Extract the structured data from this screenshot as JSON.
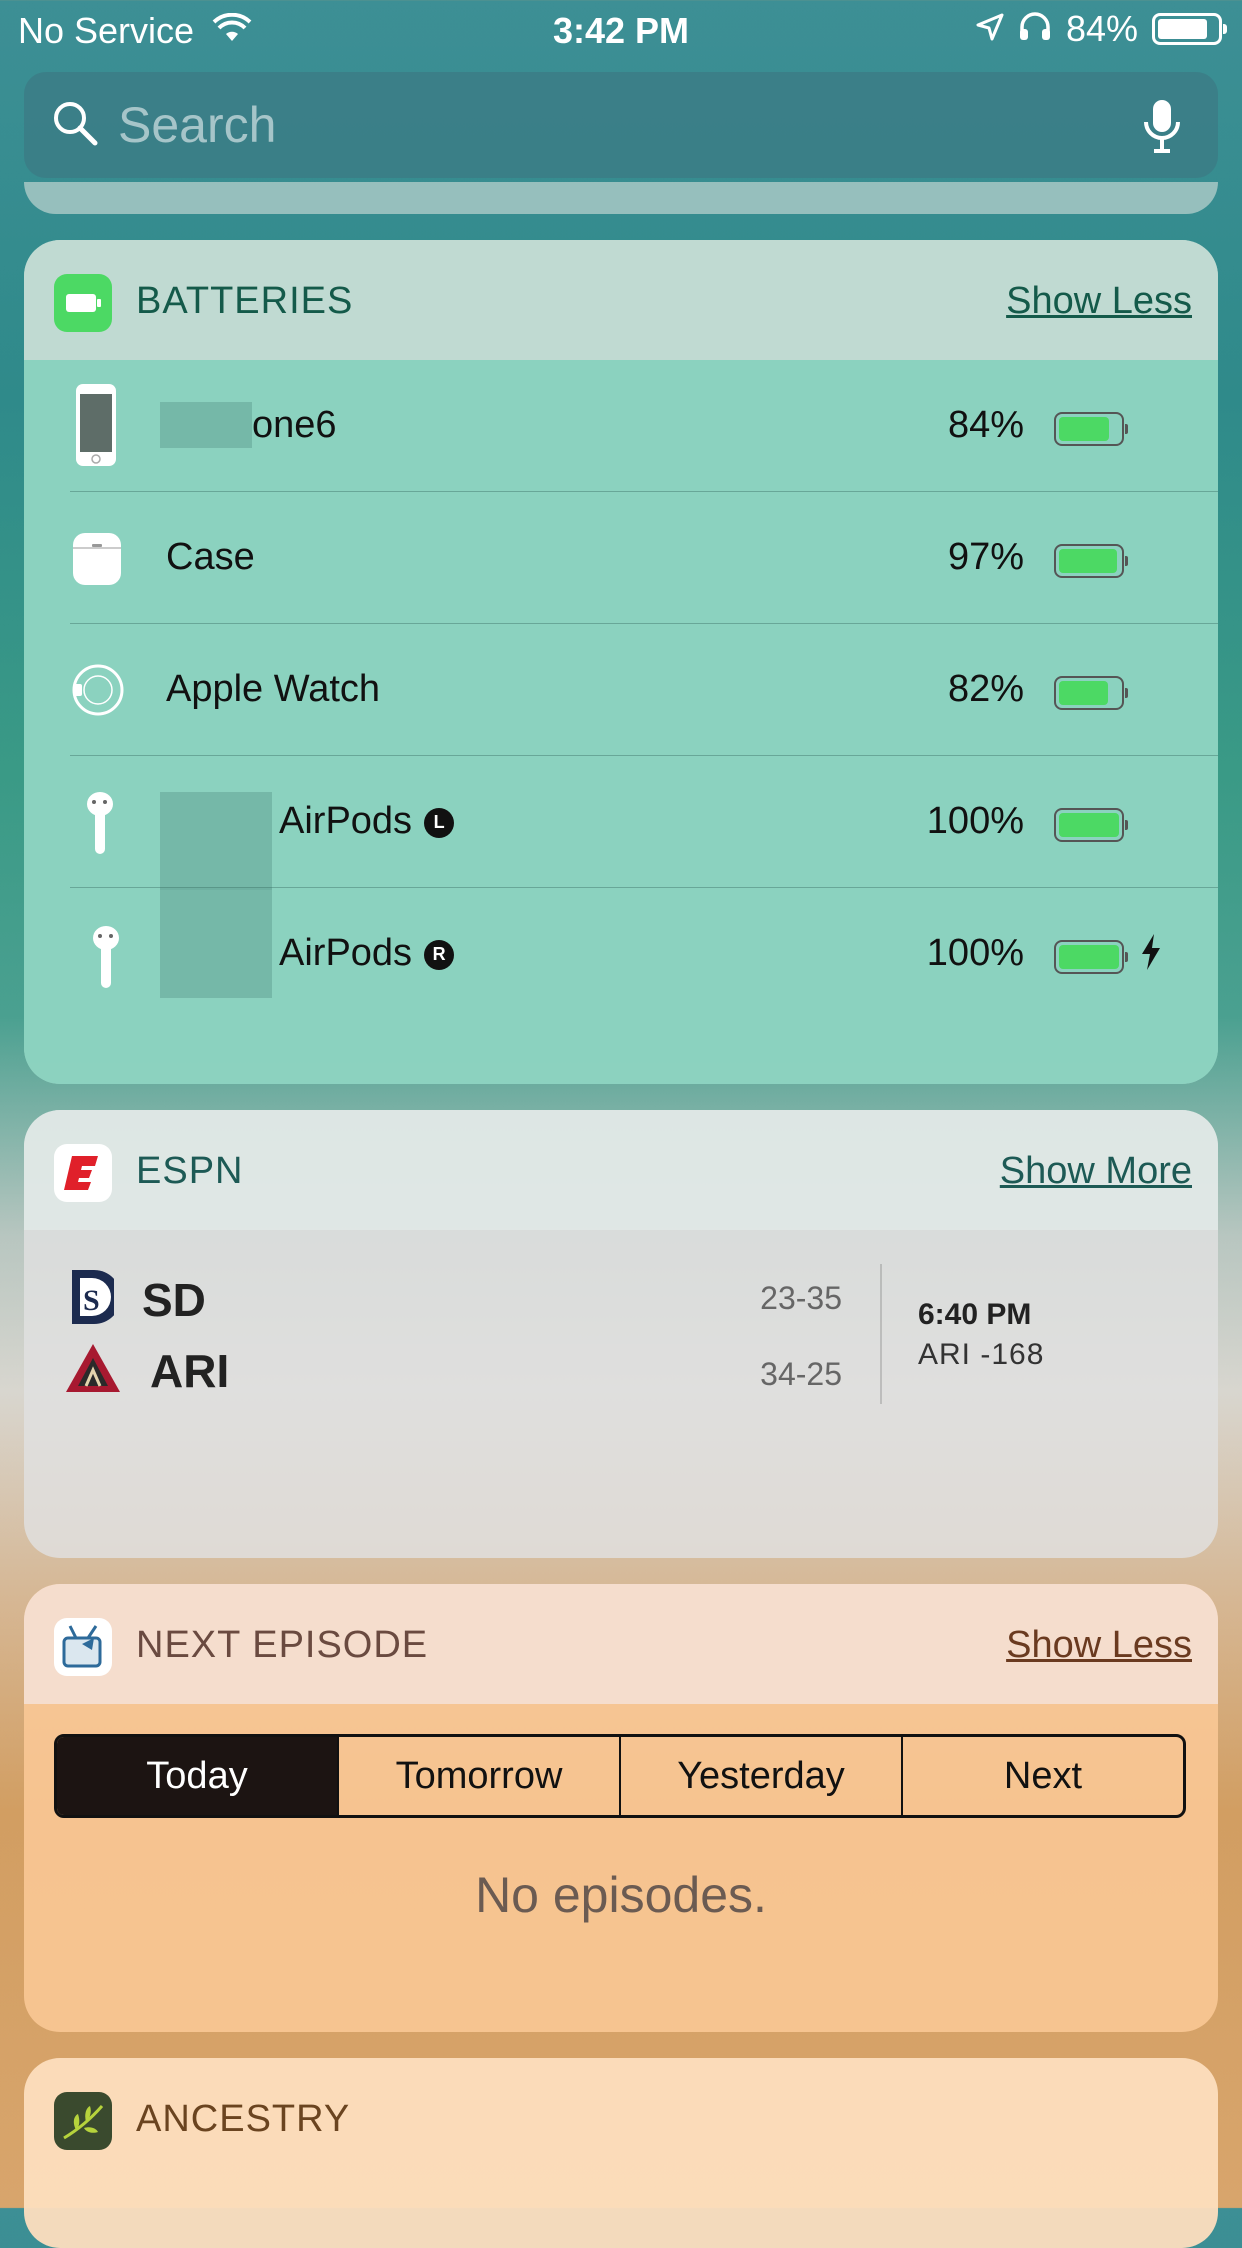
{
  "status_bar": {
    "carrier": "No Service",
    "time": "3:42 PM",
    "battery_pct": "84%",
    "battery_level": 0.84
  },
  "search": {
    "placeholder": "Search"
  },
  "batteries": {
    "title": "BATTERIES",
    "action": "Show Less",
    "devices": [
      {
        "name": "one6",
        "percent": "84%",
        "level": 0.84,
        "icon": "iphone-icon",
        "charging": false,
        "side": ""
      },
      {
        "name": "Case",
        "percent": "97%",
        "level": 0.97,
        "icon": "airpods-case-icon",
        "charging": false,
        "side": ""
      },
      {
        "name": "Apple Watch",
        "percent": "82%",
        "level": 0.82,
        "icon": "apple-watch-icon",
        "charging": false,
        "side": ""
      },
      {
        "name": "AirPods",
        "percent": "100%",
        "level": 1.0,
        "icon": "airpod-icon",
        "charging": false,
        "side": "L"
      },
      {
        "name": "AirPods",
        "percent": "100%",
        "level": 1.0,
        "icon": "airpod-icon",
        "charging": true,
        "side": "R"
      }
    ]
  },
  "espn": {
    "title": "ESPN",
    "action": "Show More",
    "game": {
      "teams": [
        {
          "abbr": "SD",
          "record": "23-35"
        },
        {
          "abbr": "ARI",
          "record": "34-25"
        }
      ],
      "time": "6:40 PM",
      "line": "ARI -168"
    }
  },
  "next_episode": {
    "title": "NEXT EPISODE",
    "action": "Show Less",
    "tabs": [
      "Today",
      "Tomorrow",
      "Yesterday",
      "Next"
    ],
    "empty_message": "No episodes."
  },
  "ancestry": {
    "title": "ANCESTRY"
  },
  "colors": {
    "battery_green": "#4cd964",
    "espn_red": "#e0202a",
    "batteries_icon": "#4cd964"
  }
}
